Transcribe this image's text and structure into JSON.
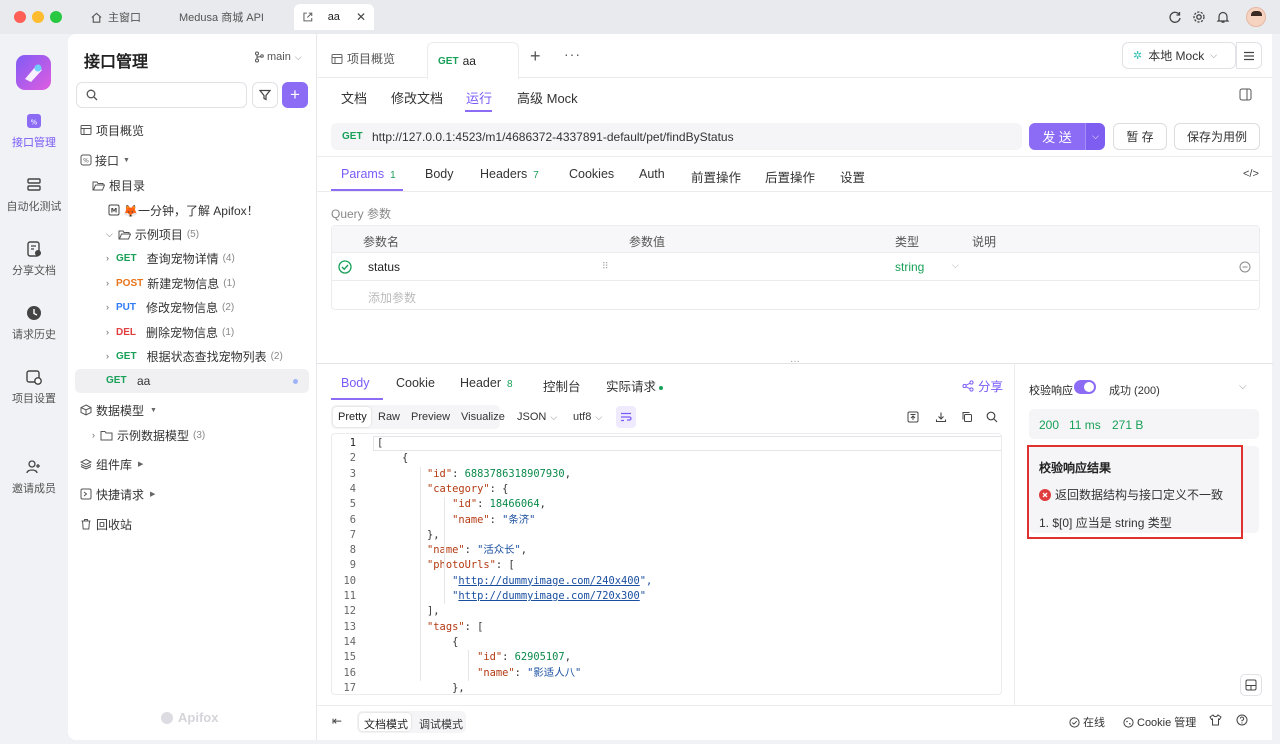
{
  "window": {
    "tabs": [
      {
        "label": "主窗口"
      },
      {
        "label": "Medusa 商城 API"
      },
      {
        "label": "aa"
      }
    ]
  },
  "leftnav": {
    "items": [
      {
        "label": "接口管理"
      },
      {
        "label": "自动化测试"
      },
      {
        "label": "分享文档"
      },
      {
        "label": "请求历史"
      },
      {
        "label": "项目设置"
      },
      {
        "label": "邀请成员"
      }
    ]
  },
  "sidebar": {
    "title": "接口管理",
    "branch": "main",
    "search_placeholder": "",
    "tree": {
      "overview": "项目概览",
      "api": "接口",
      "root": "根目录",
      "intro": "🦊一分钟，了解 Apifox！",
      "example_folder": "示例项目",
      "example_count": "(5)",
      "items": [
        {
          "method": "GET",
          "name": "查询宠物详情",
          "count": "(4)"
        },
        {
          "method": "POST",
          "name": "新建宠物信息",
          "count": "(1)"
        },
        {
          "method": "PUT",
          "name": "修改宠物信息",
          "count": "(2)"
        },
        {
          "method": "DEL",
          "name": "删除宠物信息",
          "count": "(1)"
        },
        {
          "method": "GET",
          "name": "根据状态查找宠物列表",
          "count": "(2)"
        }
      ],
      "selected": {
        "method": "GET",
        "name": "aa"
      },
      "data_model": "数据模型",
      "example_model": "示例数据模型",
      "example_model_count": "(3)",
      "components": "组件库",
      "quick_request": "快捷请求",
      "trash": "回收站"
    },
    "watermark": "Apifox"
  },
  "tabs": {
    "overview": "项目概览",
    "current_method": "GET",
    "current_name": "aa",
    "env": "本地 Mock"
  },
  "subtabs": [
    "文档",
    "修改文档",
    "运行",
    "高级 Mock"
  ],
  "request": {
    "method": "GET",
    "url": "http://127.0.0.1:4523/m1/4686372-4337891-default/pet/findByStatus",
    "send": "发 送",
    "save": "暂 存",
    "save_case": "保存为用例"
  },
  "params_tabs": {
    "params": "Params",
    "params_count": "1",
    "body": "Body",
    "headers": "Headers",
    "headers_count": "7",
    "cookies": "Cookies",
    "auth": "Auth",
    "pre": "前置操作",
    "post": "后置操作",
    "settings": "设置"
  },
  "query": {
    "section": "Query 参数",
    "col_name": "参数名",
    "col_value": "参数值",
    "col_type": "类型",
    "col_desc": "说明",
    "row_name": "status",
    "row_type": "string",
    "add": "添加参数"
  },
  "response_tabs": {
    "body": "Body",
    "cookie": "Cookie",
    "header": "Header",
    "header_count": "8",
    "console": "控制台",
    "actual": "实际请求",
    "share": "分享"
  },
  "format": {
    "pretty": "Pretty",
    "raw": "Raw",
    "preview": "Preview",
    "visualize": "Visualize",
    "json": "JSON",
    "enc": "utf8"
  },
  "code": [
    {
      "n": "1",
      "t": "["
    },
    {
      "n": "2",
      "t": "    {"
    },
    {
      "n": "3",
      "k": "\"id\"",
      "v": "6883786318907930",
      "vt": "num",
      "indent": "        "
    },
    {
      "n": "4",
      "k": "\"category\"",
      "v": "{",
      "vt": "pun",
      "indent": "        ",
      "nocomma": true
    },
    {
      "n": "5",
      "k": "\"id\"",
      "v": "18466064",
      "vt": "num",
      "indent": "            "
    },
    {
      "n": "6",
      "k": "\"name\"",
      "v": "\"条济\"",
      "vt": "str",
      "indent": "            ",
      "nocomma": true
    },
    {
      "n": "7",
      "t": "        },"
    },
    {
      "n": "8",
      "k": "\"name\"",
      "v": "\"活众长\"",
      "vt": "str",
      "indent": "        "
    },
    {
      "n": "9",
      "k": "\"photoUrls\"",
      "v": "[",
      "vt": "pun",
      "indent": "        ",
      "nocomma": true
    },
    {
      "n": "10",
      "link": "http://dummyimage.com/240x400",
      "indent": "            ",
      "comma": true
    },
    {
      "n": "11",
      "link": "http://dummyimage.com/720x300",
      "indent": "            "
    },
    {
      "n": "12",
      "t": "        ],"
    },
    {
      "n": "13",
      "k": "\"tags\"",
      "v": "[",
      "vt": "pun",
      "indent": "        ",
      "nocomma": true
    },
    {
      "n": "14",
      "t": "            {"
    },
    {
      "n": "15",
      "k": "\"id\"",
      "v": "62905107",
      "vt": "num",
      "indent": "                "
    },
    {
      "n": "16",
      "k": "\"name\"",
      "v": "\"影适人八\"",
      "vt": "str",
      "indent": "                ",
      "nocomma": true
    },
    {
      "n": "17",
      "t": "            },"
    }
  ],
  "validation": {
    "label": "校验响应",
    "status": "成功 (200)",
    "code": "200",
    "time": "11 ms",
    "size": "271 B",
    "result_title": "校验响应结果",
    "error": "返回数据结构与接口定义不一致",
    "detail": "1. $[0] 应当是 string 类型"
  },
  "footer": {
    "doc_mode": "文档模式",
    "debug_mode": "调试模式",
    "online": "在线",
    "cookie": "Cookie 管理"
  },
  "colors": {
    "accent": "#8c6cf5",
    "get": "#18a058",
    "error": "#e03e3e"
  }
}
